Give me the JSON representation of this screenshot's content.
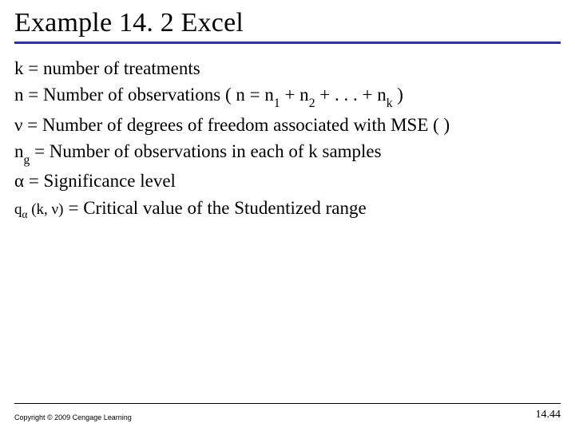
{
  "title": "Example 14. 2 Excel",
  "lines": {
    "k_def": "k = number of treatments",
    "n_label": "n = Number of observations ( n = n",
    "n_plus": " + n",
    "n_dots": " + . . . + n",
    "n_close": " )",
    "sub1": "1",
    "sub2": "2",
    "subk": "k",
    "nu": "ν",
    "nu_def": "  = Number of degrees of freedom associated with MSE ( )",
    "ng_n": "n",
    "ng_g": "g",
    "ng_def": "  = Number of observations in each of k samples",
    "alpha": "α",
    "alpha_def": " = Significance level",
    "q_prefix": "q",
    "q_alpha": "α",
    "q_args": " (k, ν)",
    "crit_def": " = Critical value of the Studentized range"
  },
  "footer": {
    "copyright": "Copyright © 2009 Cengage Learning",
    "page": "14.44"
  }
}
